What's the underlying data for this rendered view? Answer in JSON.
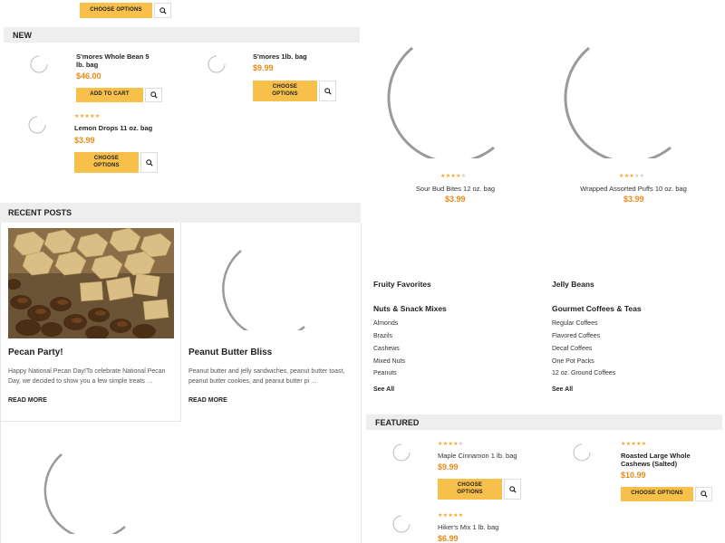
{
  "top": {
    "choose_options_label": "CHOOSE OPTIONS"
  },
  "new_section": {
    "title": "NEW",
    "products": [
      {
        "name": "S'mores Whole Bean 5 lb. bag",
        "price": "$46.00",
        "button": "ADD TO CART",
        "stars": 0
      },
      {
        "name": "S'mores 1lb. bag",
        "price": "$9.99",
        "button": "CHOOSE OPTIONS",
        "stars": 0
      },
      {
        "name": "Lemon Drops 11 oz. bag",
        "price": "$3.99",
        "button": "CHOOSE OPTIONS",
        "stars": 5
      }
    ]
  },
  "big_products": [
    {
      "name": "Sour Bud Bites 12 oz. bag",
      "price": "$3.99",
      "stars": 4
    },
    {
      "name": "Wrapped Assorted Puffs 10 oz. bag",
      "price": "$3.99",
      "stars": 3
    }
  ],
  "recent_posts": {
    "title": "RECENT POSTS",
    "posts": [
      {
        "title": "Pecan Party!",
        "excerpt": "Happy National Pecan Day!To celebrate National Pecan Day, we decided to show you a few simple treats …",
        "read_more": "READ MORE"
      },
      {
        "title": "Peanut Butter Bliss",
        "excerpt": "Peanut butter and jelly sandwiches, peanut butter toast, peanut butter cookies, and peanut butter pi …",
        "read_more": "READ MORE"
      }
    ]
  },
  "categories": {
    "col1": {
      "fruity": "Fruity Favorites",
      "nuts_title": "Nuts & Snack Mixes",
      "nuts_links": [
        "Almonds",
        "Brazils",
        "Cashews",
        "Mixed Nuts",
        "Peanuts"
      ],
      "see_all": "See All"
    },
    "col2": {
      "jelly": "Jelly Beans",
      "coffee_title": "Gourmet Coffees & Teas",
      "coffee_links": [
        "Regular Coffees",
        "Flavored Coffees",
        "Decaf Coffees",
        "One Pot Packs",
        "12 oz. Ground Coffees"
      ],
      "see_all": "See All"
    }
  },
  "featured": {
    "title": "FEATURED",
    "products": [
      {
        "name": "Maple Cinnamon 1 lb. bag",
        "price": "$9.99",
        "button": "CHOOSE OPTIONS",
        "stars": 4
      },
      {
        "name": "Roasted Large Whole Cashews (Salted)",
        "price": "$10.99",
        "button": "CHOOSE OPTIONS",
        "stars": 5
      },
      {
        "name": "Hiker's Mix 1 lb. bag",
        "price": "$6.99",
        "stars": 5
      }
    ]
  },
  "colors": {
    "accent": "#f7c04a",
    "price": "#e88a1a",
    "header_bg": "#eeeeee"
  }
}
